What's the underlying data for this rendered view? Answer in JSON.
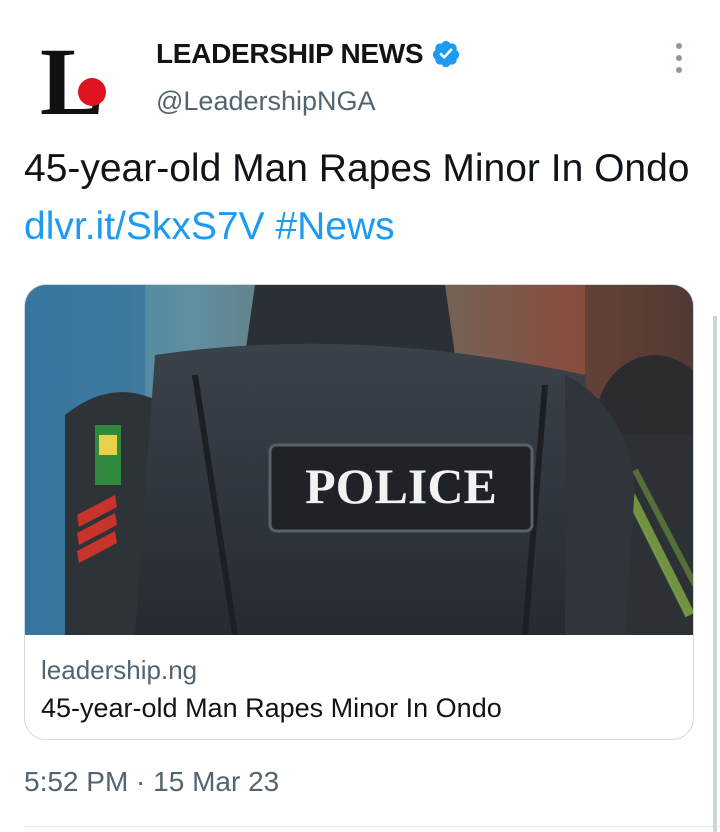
{
  "tweet": {
    "author": {
      "logo_letter": "L",
      "display_name": "LEADERSHIP NEWS",
      "verified": true,
      "verified_icon": "verified-badge-icon",
      "handle": "@LeadershipNGA"
    },
    "text": "45-year-old Man Rapes Minor In Ondo",
    "link": "dlvr.it/SkxS7V",
    "hashtag": "#News",
    "card": {
      "image_label": "POLICE",
      "domain": "leadership.ng",
      "title": "45-year-old Man Rapes Minor In Ondo"
    },
    "timestamp": "5:52 PM · 15 Mar 23"
  },
  "colors": {
    "link": "#1d9bf0",
    "secondary_text": "#536471",
    "verified": "#1d9bf0",
    "logo_dot": "#e0141e"
  }
}
